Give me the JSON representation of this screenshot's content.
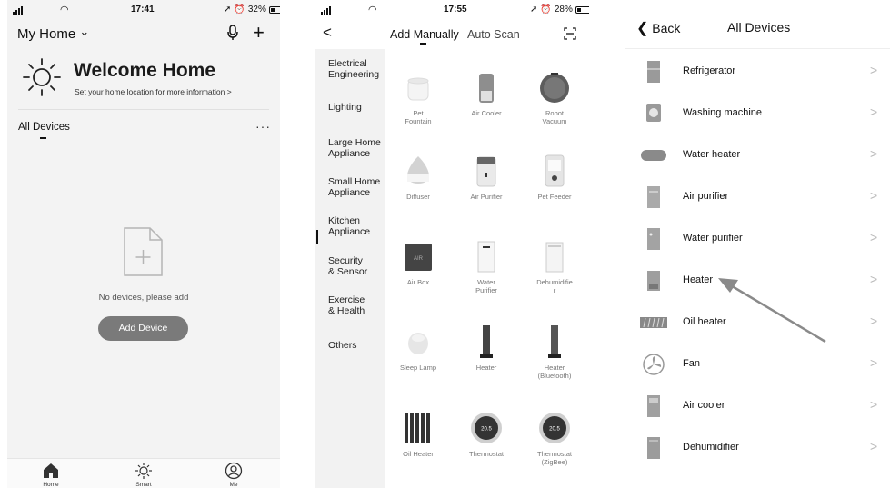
{
  "panel1": {
    "status": {
      "time": "17:41",
      "battery": "32%"
    },
    "home_label": "My Home",
    "chevron_glyph": "⌄",
    "welcome_title": "Welcome Home",
    "welcome_sub": "Set your home location for more information  >",
    "all_devices": "All Devices",
    "more_glyph": "···",
    "empty_text": "No devices, please add",
    "add_device_label": "Add Device",
    "tabs": [
      {
        "label": "Home",
        "icon": "home-icon"
      },
      {
        "label": "Smart",
        "icon": "sun-icon"
      },
      {
        "label": "Me",
        "icon": "profile-icon"
      }
    ]
  },
  "panel2": {
    "status": {
      "time": "17:55",
      "battery": "28%"
    },
    "back_glyph": "<",
    "tab_manual": "Add Manually",
    "tab_scan": "Auto Scan",
    "categories": [
      "Electrical\nEngineering",
      "Lighting",
      "Large Home\nAppliance",
      "Small Home\nAppliance",
      "Kitchen\nAppliance",
      "Security\n& Sensor",
      "Exercise\n& Health",
      "Others"
    ],
    "devices": [
      {
        "label": "Pet\nFountain",
        "icon": "pet-fountain-icon"
      },
      {
        "label": "Air Cooler",
        "icon": "air-cooler-icon"
      },
      {
        "label": "Robot\nVacuum",
        "icon": "robot-vacuum-icon"
      },
      {
        "label": "Diffuser",
        "icon": "diffuser-icon"
      },
      {
        "label": "Air Purifier",
        "icon": "air-purifier-icon"
      },
      {
        "label": "Pet Feeder",
        "icon": "pet-feeder-icon"
      },
      {
        "label": "Air Box",
        "icon": "air-box-icon"
      },
      {
        "label": "Water\nPurifier",
        "icon": "water-purifier-icon"
      },
      {
        "label": "Dehumidifie\nr",
        "icon": "dehumidifier-icon"
      },
      {
        "label": "Sleep Lamp",
        "icon": "sleep-lamp-icon"
      },
      {
        "label": "Heater",
        "icon": "heater-icon"
      },
      {
        "label": "Heater\n(Bluetooth)",
        "icon": "heater-bluetooth-icon"
      },
      {
        "label": "Oil Heater",
        "icon": "oil-heater-icon"
      },
      {
        "label": "Thermostat",
        "icon": "thermostat-icon",
        "readout": "20.5"
      },
      {
        "label": "Thermostat\n(ZigBee)",
        "icon": "thermostat-zigbee-icon",
        "readout": "20.5"
      }
    ]
  },
  "panel3": {
    "back_label": "Back",
    "title": "All Devices",
    "chevron_glyph": ">",
    "items": [
      {
        "label": "Refrigerator",
        "icon": "refrigerator-icon"
      },
      {
        "label": "Washing machine",
        "icon": "washing-machine-icon"
      },
      {
        "label": "Water heater",
        "icon": "water-heater-icon"
      },
      {
        "label": "Air purifier",
        "icon": "air-purifier-icon"
      },
      {
        "label": "Water purifier",
        "icon": "water-purifier-icon"
      },
      {
        "label": "Heater",
        "icon": "heater-icon"
      },
      {
        "label": "Oil heater",
        "icon": "oil-heater-icon"
      },
      {
        "label": "Fan",
        "icon": "fan-icon"
      },
      {
        "label": "Air cooler",
        "icon": "air-cooler-icon"
      },
      {
        "label": "Dehumidifier",
        "icon": "dehumidifier-icon"
      }
    ]
  },
  "colors": {
    "button_gray": "#7a7a7a",
    "sidebar_bg": "#f2f2f2",
    "arrow_gray": "#8a8a8a"
  }
}
